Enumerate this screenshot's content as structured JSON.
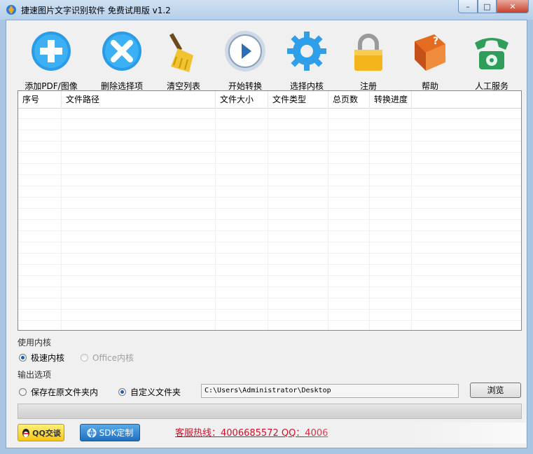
{
  "window": {
    "title": "捷速图片文字识别软件 免费试用版 v1.2",
    "controls": {
      "minimize": "–",
      "maximize": "□",
      "close": "✕"
    }
  },
  "toolbar": [
    {
      "label": "添加PDF/图像",
      "icon": "add-icon"
    },
    {
      "label": "删除选择项",
      "icon": "delete-icon"
    },
    {
      "label": "清空列表",
      "icon": "broom-icon"
    },
    {
      "label": "开始转换",
      "icon": "play-icon"
    },
    {
      "label": "选择内核",
      "icon": "gear-icon"
    },
    {
      "label": "注册",
      "icon": "lock-icon"
    },
    {
      "label": "帮助",
      "icon": "help-book-icon"
    },
    {
      "label": "人工服务",
      "icon": "phone-icon"
    }
  ],
  "file_list": {
    "columns": [
      "序号",
      "文件路径",
      "文件大小",
      "文件类型",
      "总页数",
      "转换进度"
    ],
    "rows": []
  },
  "engine": {
    "label": "使用内核",
    "options": [
      {
        "label": "极速内核",
        "selected": true,
        "enabled": true
      },
      {
        "label": "Office内核",
        "selected": false,
        "enabled": false
      }
    ]
  },
  "output": {
    "label": "输出选项",
    "options": [
      {
        "label": "保存在原文件夹内",
        "selected": false
      },
      {
        "label": "自定义文件夹",
        "selected": true
      }
    ],
    "path": "C:\\Users\\Administrator\\Desktop",
    "browse_label": "浏览"
  },
  "progress": {
    "value": 0
  },
  "footer": {
    "qq_label": "QQ交谈",
    "sdk_label": "SDK定制",
    "hotline": "客服热线：4006685572 QQ：4006"
  },
  "colors": {
    "hotline": "#d0102a",
    "accent": "#1a5fb4"
  }
}
